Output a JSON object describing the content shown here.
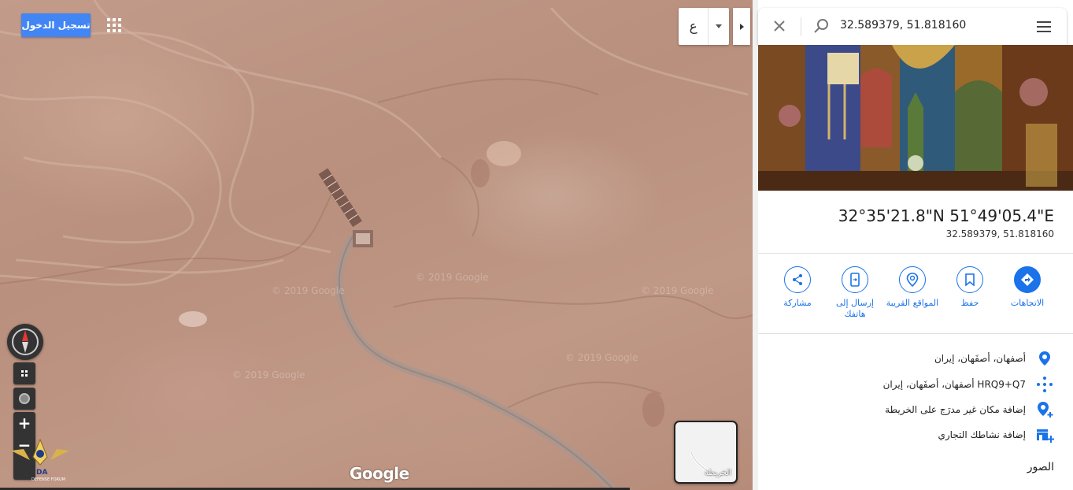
{
  "map": {
    "signin_label": "تسجيل الدخول",
    "language_label": "ع",
    "watermark": "© 2019 Google",
    "google_logo": "Google",
    "map_type_label": "الخريطة",
    "forum_logo_text": "DA",
    "forum_logo_subtext": "DEFENSE FORUM"
  },
  "search": {
    "value": "32.589379, 51.818160"
  },
  "place": {
    "coords_dms": "32°35'21.8\"N 51°49'05.4\"E",
    "coords_decimal": "32.589379, 51.818160"
  },
  "actions": [
    {
      "label": "الاتجاهات",
      "icon": "directions-icon"
    },
    {
      "label": "حفظ",
      "icon": "bookmark-icon"
    },
    {
      "label": "المواقع القريبة",
      "icon": "nearby-icon"
    },
    {
      "label": "إرسال إلى هاتفك",
      "icon": "send-to-phone-icon"
    },
    {
      "label": "مشاركة",
      "icon": "share-icon"
    }
  ],
  "info": [
    {
      "text": "أصفهان، أصفَهان، إيران",
      "icon": "location-pin-icon"
    },
    {
      "text": "HRQ9+Q7 أصفهان، أصفَهان، إيران",
      "icon": "plus-code-icon"
    },
    {
      "text": "إضافة مكان غير مدرَج على الخريطة",
      "icon": "add-place-icon"
    },
    {
      "text": "إضافة نشاطك التجاري",
      "icon": "add-business-icon"
    }
  ],
  "photos_title": "الصور",
  "colors": {
    "accent": "#1a73e8",
    "signin": "#4285f4",
    "terrain": "#c09886"
  }
}
